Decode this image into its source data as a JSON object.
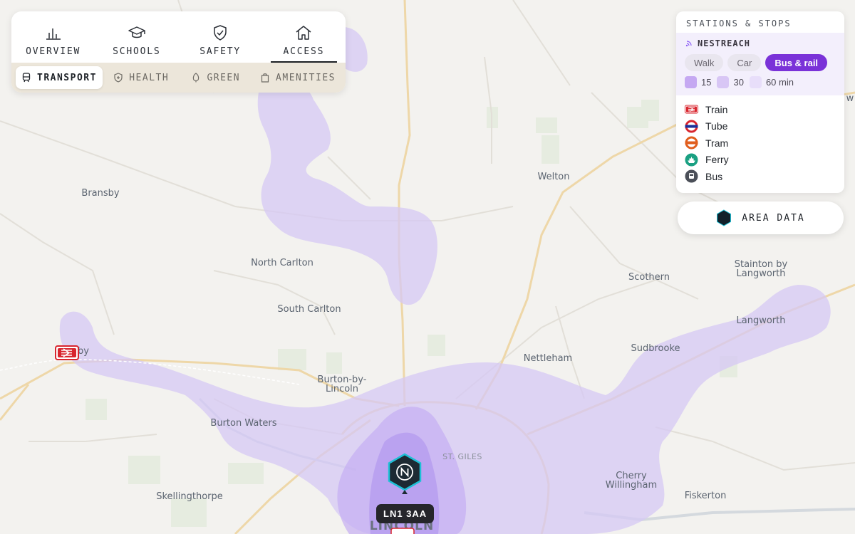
{
  "tabs": {
    "main": [
      {
        "label": "OVERVIEW",
        "icon": "bar-chart-icon"
      },
      {
        "label": "SCHOOLS",
        "icon": "graduation-cap-icon"
      },
      {
        "label": "SAFETY",
        "icon": "shield-check-icon"
      },
      {
        "label": "ACCESS",
        "icon": "home-icon",
        "active": true
      }
    ],
    "sub": [
      {
        "label": "TRANSPORT",
        "icon": "train-icon",
        "active": true
      },
      {
        "label": "HEALTH",
        "icon": "health-shield-icon"
      },
      {
        "label": "GREEN",
        "icon": "tree-icon"
      },
      {
        "label": "AMENITIES",
        "icon": "shopping-bag-icon"
      }
    ]
  },
  "legend": {
    "title": "STATIONS & STOPS",
    "nestreach": {
      "label": "NESTREACH",
      "modes": [
        "Walk",
        "Car",
        "Bus & rail"
      ],
      "active_mode": "Bus & rail",
      "times": [
        {
          "label": "15",
          "color": "#c5a8f2"
        },
        {
          "label": "30",
          "color": "#d8c6f5"
        },
        {
          "label": "60 min",
          "color": "#e8defa"
        }
      ]
    },
    "stops": [
      {
        "label": "Train",
        "icon": "national-rail-icon",
        "color": "#d8262f"
      },
      {
        "label": "Tube",
        "icon": "underground-roundel-icon",
        "color": "#1b2f9a"
      },
      {
        "label": "Tram",
        "icon": "tram-icon",
        "color": "#e05e1e"
      },
      {
        "label": "Ferry",
        "icon": "ferry-icon",
        "color": "#1aa082"
      },
      {
        "label": "Bus",
        "icon": "bus-icon",
        "color": "#4b4f58"
      }
    ]
  },
  "area_button": {
    "label": "AREA DATA"
  },
  "map": {
    "postcode": "LN1 3AA",
    "accent": "#a48cf0",
    "places": [
      {
        "name": "Bransby"
      },
      {
        "name": "North Carlton"
      },
      {
        "name": "South Carlton"
      },
      {
        "name": "Burton-by-"
      },
      {
        "name": "Lincoln"
      },
      {
        "name": "Burton Waters"
      },
      {
        "name": "Skellingthorpe"
      },
      {
        "name": "Welton"
      },
      {
        "name": "Scothern"
      },
      {
        "name": "Stainton by"
      },
      {
        "name": "Langworth"
      },
      {
        "name": "Langworth"
      },
      {
        "name": "Sudbrooke"
      },
      {
        "name": "Nettleham"
      },
      {
        "name": "ST. GILES"
      },
      {
        "name": "Cherry"
      },
      {
        "name": "Willingham"
      },
      {
        "name": "Fiskerton"
      },
      {
        "name": "LINCOLN"
      },
      {
        "name": "by"
      },
      {
        "name": "w"
      }
    ]
  }
}
